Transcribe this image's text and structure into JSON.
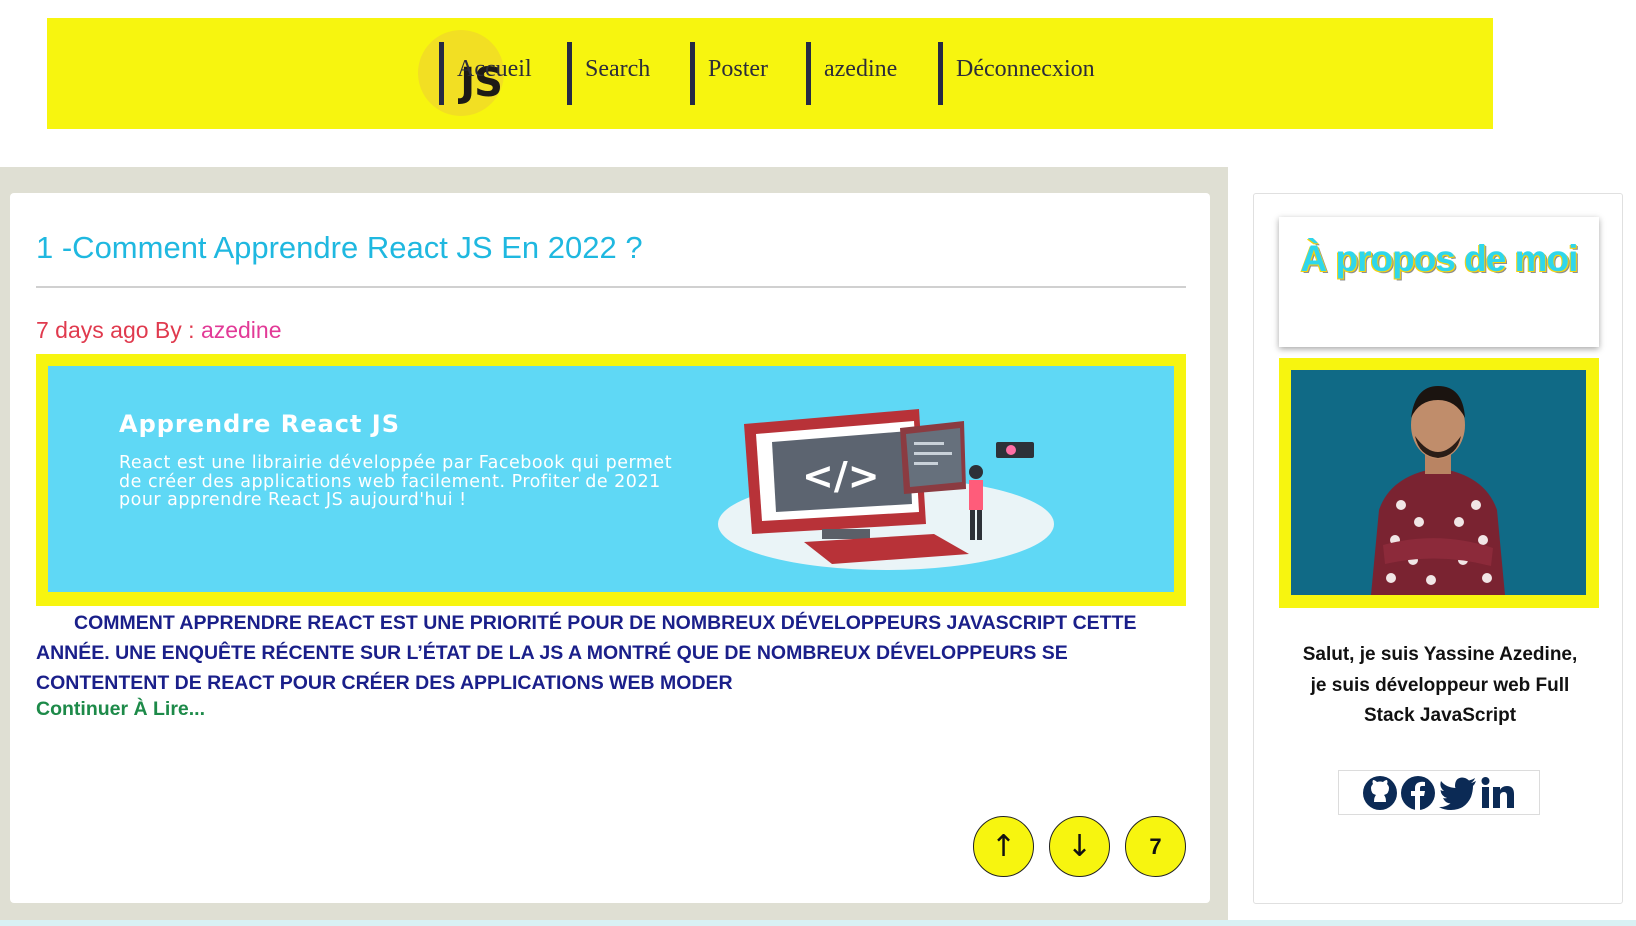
{
  "header": {
    "logo_text": "JS",
    "nav": [
      "Accueil",
      "Search",
      "Poster",
      "azedine",
      "Déconnecxion"
    ]
  },
  "post": {
    "title": "1 -Comment Apprendre React JS En 2022 ?",
    "meta_prefix": "7 days ago By : ",
    "author": "azedine",
    "image_heading": "Apprendre React JS",
    "image_text": "React est une librairie développée par Facebook qui permet de créer des applications web facilement. Profiter de 2021 pour apprendre React JS aujourd'hui !",
    "excerpt": "Comment apprendre React est une priorité pour de nombreux développeurs JavaScript cette année. Une enquête récente sur l’état de la JS a montré que de nombreux développeurs se contentent de React pour créer des applications web moder",
    "read_more": "Continuer À Lire...",
    "up_label": "↑",
    "down_label": "↓",
    "vote_count": "7"
  },
  "sidebar": {
    "about_title": "À propos de moi",
    "bio": "Salut, je suis Yassine Azedine, je suis développeur web Full Stack JavaScript",
    "social_icons": [
      "github-icon",
      "facebook-icon",
      "twitter-icon",
      "linkedin-icon"
    ]
  },
  "colors": {
    "accent_yellow": "#f7f50f",
    "title_blue": "#1fb8e0",
    "excerpt_navy": "#1a1f8a",
    "link_green": "#1d8a49",
    "meta_red": "#e03a4e"
  }
}
